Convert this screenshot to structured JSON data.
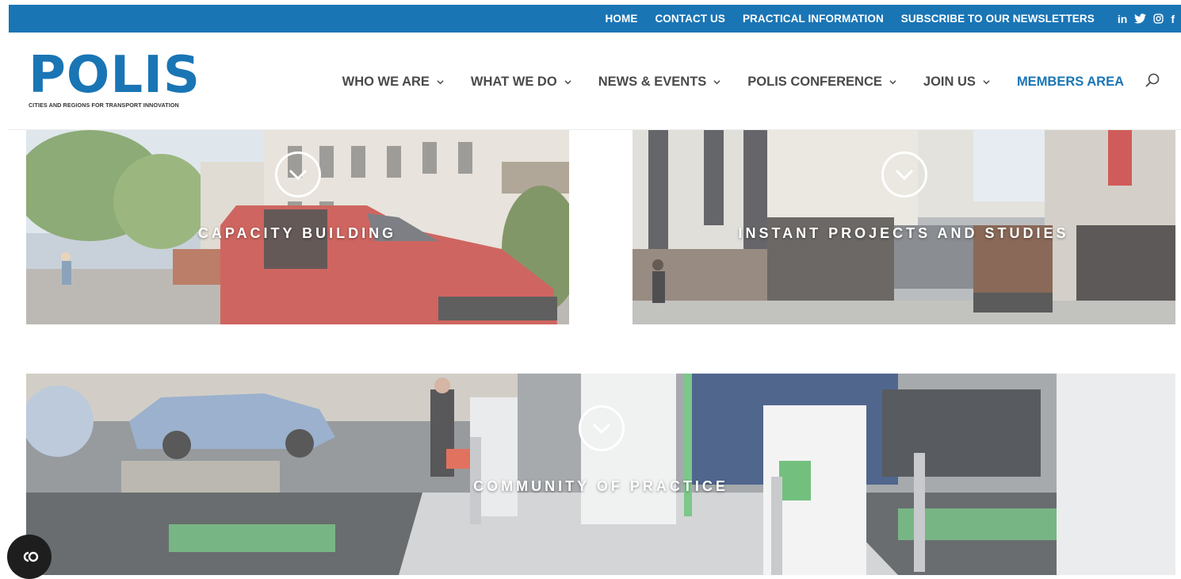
{
  "topbar": {
    "links": [
      "HOME",
      "CONTACT US",
      "PRACTICAL INFORMATION",
      "SUBSCRIBE TO OUR NEWSLETTERS"
    ],
    "social": {
      "linkedin": "in",
      "facebook": "f"
    },
    "color": "#1a75b5"
  },
  "logo": {
    "wordmark": "POLIS",
    "tagline": "CITIES AND REGIONS FOR TRANSPORT INNOVATION"
  },
  "nav": {
    "items": [
      "WHO WE ARE",
      "WHAT WE DO",
      "NEWS & EVENTS",
      "POLIS CONFERENCE",
      "JOIN US"
    ],
    "members": "MEMBERS AREA"
  },
  "tiles": [
    {
      "title": "CAPACITY BUILDING",
      "icon": "chevron-down-circle-icon"
    },
    {
      "title": "INSTANT PROJECTS AND STUDIES",
      "icon": "chevron-down-circle-icon"
    },
    {
      "title": "COMMUNITY OF PRACTICE",
      "icon": "chevron-down-circle-icon"
    }
  ],
  "cookie_button": {
    "icon": "cookie-settings-icon"
  }
}
